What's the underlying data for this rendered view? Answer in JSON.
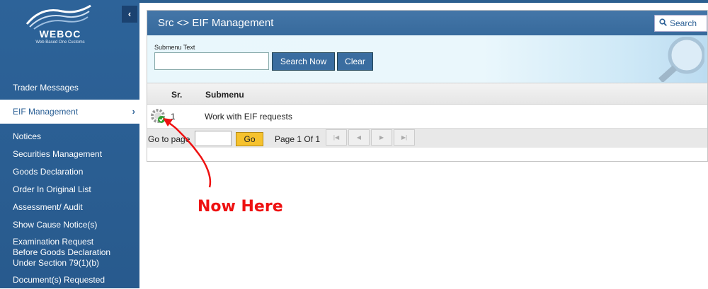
{
  "sidebar": {
    "logo_title": "WEBOC",
    "logo_subtitle": "Web Based One Customs",
    "collapse_label": "‹",
    "items": [
      {
        "label": "Trader Messages"
      },
      {
        "label": "EIF Management",
        "active": true
      },
      {
        "label": "Notices"
      },
      {
        "label": "Securities Management"
      },
      {
        "label": "Goods Declaration"
      },
      {
        "label": "Order In Original List"
      },
      {
        "label": "Assessment/ Audit"
      },
      {
        "label": "Show Cause Notice(s)"
      },
      {
        "label": "Examination Request Before Goods Declaration Under Section 79(1)(b)"
      },
      {
        "label": "Document(s) Requested"
      }
    ],
    "active_chevron": "›"
  },
  "panel": {
    "title": "Src <> EIF Management",
    "search_label": "Search",
    "filter": {
      "label": "Submenu Text",
      "value": "",
      "search_button": "Search Now",
      "clear_button": "Clear"
    },
    "table": {
      "columns": [
        "Sr.",
        "Submenu"
      ],
      "rows": [
        {
          "sr": "1",
          "submenu": "Work with EIF requests"
        }
      ]
    },
    "pager": {
      "goto_label": "Go to page",
      "page_value": "",
      "go_button": "Go",
      "page_info": "Page 1 Of 1"
    }
  },
  "annotation": {
    "text": "Now Here",
    "color": "#ee1111"
  },
  "colors": {
    "sidebar_bg": "#2a5f95",
    "header_bg": "#3c6e9f",
    "go_button": "#f6c22e"
  }
}
